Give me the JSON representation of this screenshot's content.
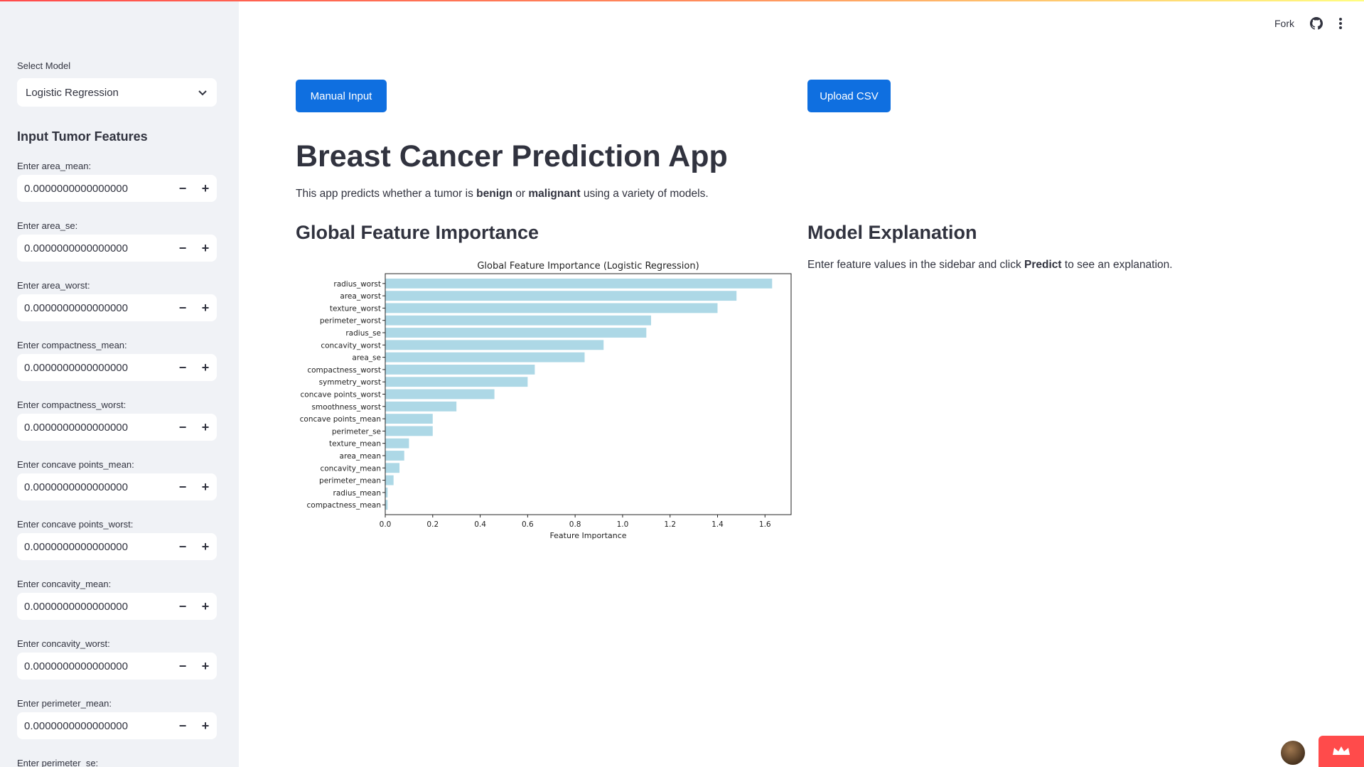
{
  "header": {
    "fork_label": "Fork"
  },
  "sidebar": {
    "select_label": "Select Model",
    "selected_model": "Logistic Regression",
    "section_title": "Input Tumor Features",
    "inputs": [
      {
        "label": "Enter area_mean:",
        "value": "0.0000000000000000"
      },
      {
        "label": "Enter area_se:",
        "value": "0.0000000000000000"
      },
      {
        "label": "Enter area_worst:",
        "value": "0.0000000000000000"
      },
      {
        "label": "Enter compactness_mean:",
        "value": "0.0000000000000000"
      },
      {
        "label": "Enter compactness_worst:",
        "value": "0.0000000000000000"
      },
      {
        "label": "Enter concave points_mean:",
        "value": "0.0000000000000000"
      },
      {
        "label": "Enter concave points_worst:",
        "value": "0.0000000000000000"
      },
      {
        "label": "Enter concavity_mean:",
        "value": "0.0000000000000000"
      },
      {
        "label": "Enter concavity_worst:",
        "value": "0.0000000000000000"
      },
      {
        "label": "Enter perimeter_mean:",
        "value": "0.0000000000000000"
      },
      {
        "label": "Enter perimeter_se:",
        "value": ""
      }
    ],
    "minus": "−",
    "plus": "+"
  },
  "main": {
    "manual_button": "Manual Input",
    "upload_button": "Upload CSV",
    "title": "Breast Cancer Prediction App",
    "desc_pre": "This app predicts whether a tumor is ",
    "desc_b1": "benign",
    "desc_mid": " or ",
    "desc_b2": "malignant",
    "desc_post": " using a variety of models.",
    "global_heading": "Global Feature Importance",
    "explain_heading": "Model Explanation",
    "explain_pre": "Enter feature values in the sidebar and click ",
    "explain_b": "Predict",
    "explain_post": " to see an explanation."
  },
  "chart_data": {
    "type": "bar",
    "orientation": "horizontal",
    "title": "Global Feature Importance (Logistic Regression)",
    "xlabel": "Feature Importance",
    "ylabel": "",
    "xlim": [
      0,
      1.71
    ],
    "xticks": [
      "0.0",
      "0.2",
      "0.4",
      "0.6",
      "0.8",
      "1.0",
      "1.2",
      "1.4",
      "1.6"
    ],
    "color": "#add8e6",
    "categories": [
      "radius_worst",
      "area_worst",
      "texture_worst",
      "perimeter_worst",
      "radius_se",
      "concavity_worst",
      "area_se",
      "compactness_worst",
      "symmetry_worst",
      "concave points_worst",
      "smoothness_worst",
      "concave points_mean",
      "perimeter_se",
      "texture_mean",
      "area_mean",
      "concavity_mean",
      "perimeter_mean",
      "radius_mean",
      "compactness_mean"
    ],
    "values": [
      1.63,
      1.48,
      1.4,
      1.12,
      1.1,
      0.92,
      0.84,
      0.63,
      0.6,
      0.46,
      0.3,
      0.2,
      0.2,
      0.1,
      0.08,
      0.06,
      0.035,
      0.01,
      0.01
    ]
  },
  "colors": {
    "primary": "#0f6fe0",
    "sidebar_bg": "#f0f2f6",
    "accent": "#ff4b4b"
  }
}
